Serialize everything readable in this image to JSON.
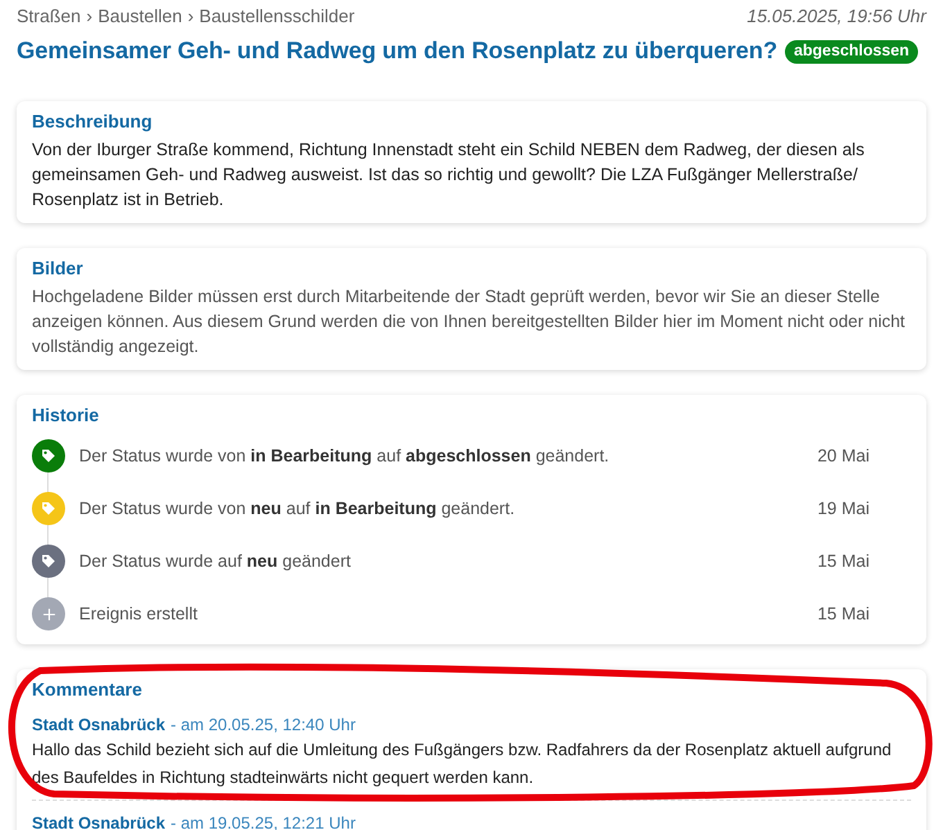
{
  "breadcrumb": [
    "Straßen",
    "Baustellen",
    "Baustellensschilder"
  ],
  "breadcrumb_separator": "›",
  "timestamp": "15.05.2025, 19:56 Uhr",
  "title": "Gemeinsamer Geh- und Radweg um den Rosenplatz zu überqueren?",
  "status_badge": "abgeschlossen",
  "description": {
    "heading": "Beschreibung",
    "text": "Von der Iburger Straße kommend, Richtung Innenstadt steht ein Schild NEBEN dem Radweg, der diesen als gemeinsamen Geh- und Radweg ausweist. Ist das so richtig und gewollt? Die LZA Fußgänger Mellerstraße/ Rosenplatz ist in Betrieb."
  },
  "images": {
    "heading": "Bilder",
    "text": "Hochgeladene Bilder müssen erst durch Mitarbeitende der Stadt geprüft werden, bevor wir Sie an dieser Stelle anzeigen können. Aus diesem Grund werden die von Ihnen bereitgestellten Bilder hier im Moment nicht oder nicht vollständig angezeigt."
  },
  "history": {
    "heading": "Historie",
    "events": [
      {
        "kind": "status",
        "color": "#0a7d0a",
        "text": "Der Status wurde von **in Bearbeitung** auf **abgeschlossen** geändert.",
        "date": "20 Mai"
      },
      {
        "kind": "status",
        "color": "#f5c518",
        "text": "Der Status wurde von **neu** auf **in Bearbeitung** geändert.",
        "date": "19 Mai"
      },
      {
        "kind": "status",
        "color": "#6b7080",
        "text": "Der Status wurde auf **neu** geändert",
        "date": "15 Mai"
      },
      {
        "kind": "created",
        "color": "#a3a8b4",
        "text": "Ereignis erstellt",
        "date": "15 Mai"
      }
    ]
  },
  "comments": {
    "heading": "Kommentare",
    "items": [
      {
        "author": "Stadt Osnabrück",
        "date": "- am 20.05.25, 12:40 Uhr",
        "text": "Hallo das Schild bezieht sich auf die Umleitung des Fußgängers bzw. Radfahrers da der Rosenplatz aktuell aufgrund des Baufeldes in Richtung stadteinwärts nicht gequert werden kann."
      },
      {
        "author": "Stadt Osnabrück",
        "date": "- am 19.05.25, 12:21 Uhr"
      }
    ]
  },
  "annotations": [
    {
      "kind": "ellipse",
      "color": "#e8000b"
    }
  ]
}
